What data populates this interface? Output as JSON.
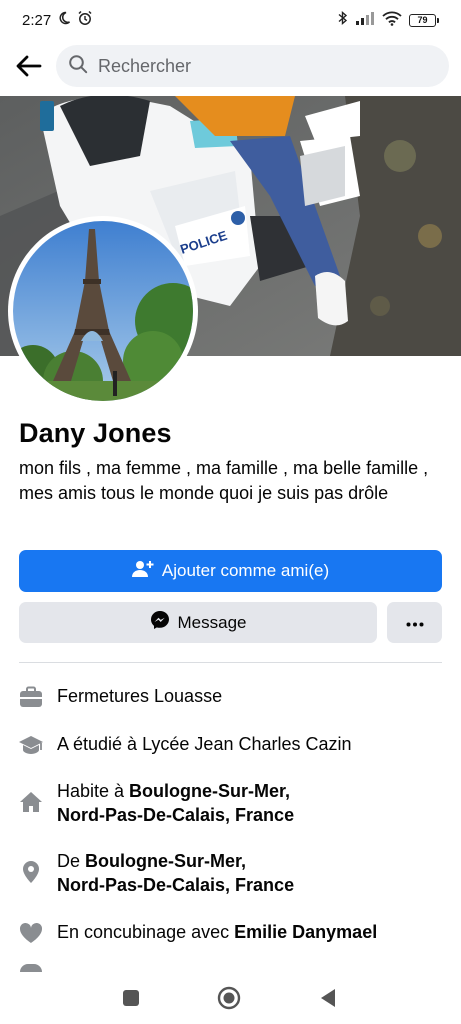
{
  "status_bar": {
    "time": "2:27",
    "battery": "79",
    "icons": [
      "moon-icon",
      "alarm-icon",
      "bluetooth-icon",
      "signal-icon",
      "wifi-icon",
      "battery-icon"
    ]
  },
  "topbar": {
    "back_icon": "arrow-left-icon",
    "search_placeholder": "Rechercher"
  },
  "profile": {
    "name": "Dany Jones",
    "bio": "mon fils , ma femme , ma famille , ma belle famille , mes amis tous le monde quoi je suis pas drôle"
  },
  "actions": {
    "add_friend": "Ajouter comme ami(e)",
    "message": "Message",
    "more_icon": "more-horizontal-icon"
  },
  "details": {
    "work": "Fermetures Louasse",
    "education": "A étudié à Lycée Jean Charles Cazin",
    "lives_prefix": "Habite à ",
    "lives_city": "Boulogne-Sur-Mer,",
    "lives_region": "Nord-Pas-De-Calais, France",
    "from_prefix": "De ",
    "from_city": "Boulogne-Sur-Mer,",
    "from_region": "Nord-Pas-De-Calais, France",
    "relationship_prefix": "En concubinage avec ",
    "relationship_partner": "Emilie Danymael"
  },
  "colors": {
    "accent": "#1877f2",
    "secondary_button": "#e4e6eb",
    "icon_gray": "#8a8d91",
    "muted_text": "#65676b"
  },
  "nav": [
    "square-icon",
    "circle-home-icon",
    "triangle-back-icon"
  ]
}
